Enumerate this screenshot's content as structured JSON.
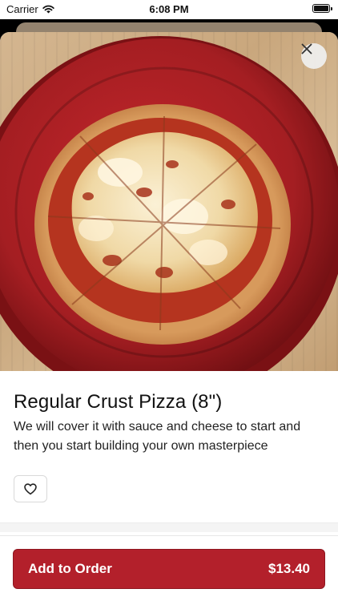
{
  "status_bar": {
    "carrier": "Carrier",
    "time": "6:08 PM",
    "battery_level": 1.0
  },
  "item": {
    "title": "Regular Crust Pizza (8\")",
    "description": "We will cover it with sauce and cheese to start and then you start building your own masterpiece",
    "image_subject": "pizza on a red plate"
  },
  "icons": {
    "close": "close-icon",
    "favorite": "heart-outline-icon",
    "wifi": "wifi-icon",
    "battery": "battery-icon"
  },
  "footer": {
    "add_label": "Add to Order",
    "price": "$13.40"
  },
  "colors": {
    "accent": "#b3202b",
    "plate": "#a41e22"
  }
}
